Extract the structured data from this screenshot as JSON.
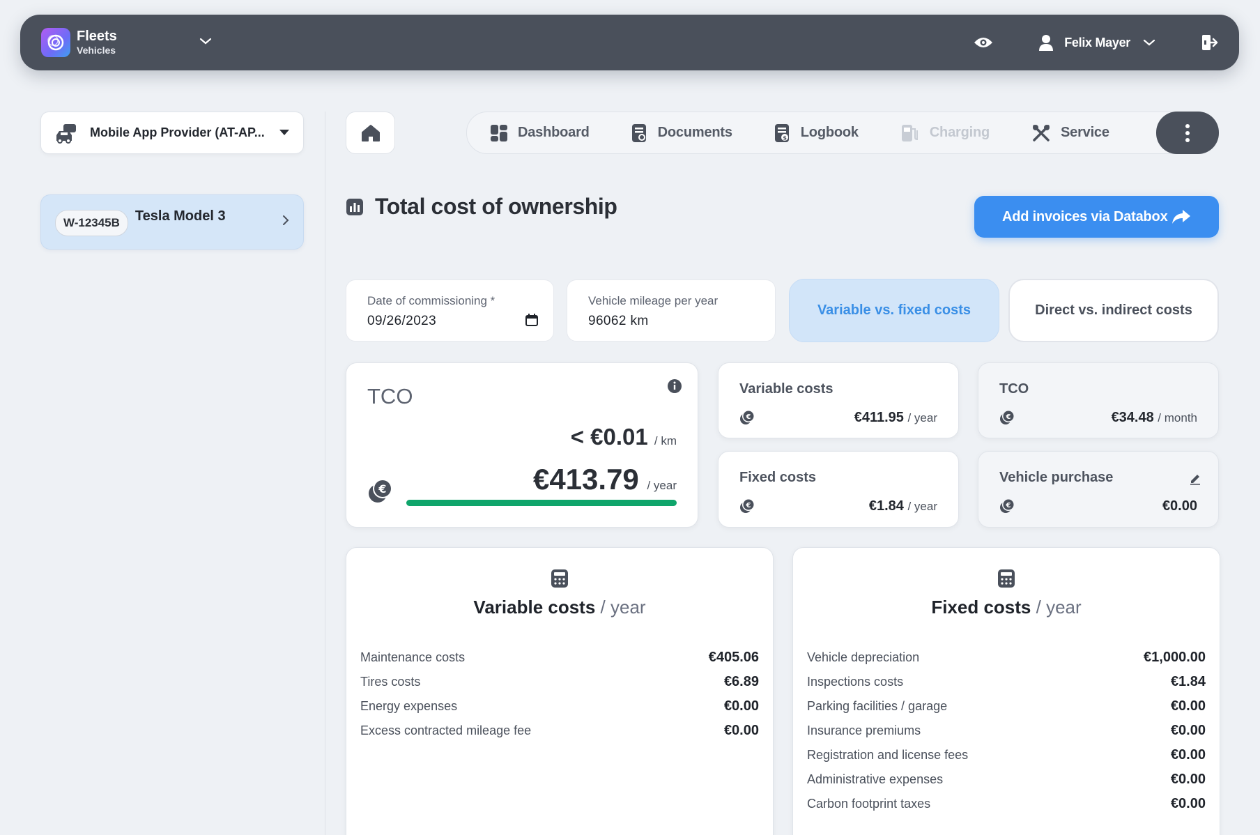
{
  "app": {
    "name": "Fleets",
    "section": "Vehicles"
  },
  "user": {
    "name": "Felix Mayer"
  },
  "provider": {
    "label": "Mobile App Provider (AT-AP..."
  },
  "vehicle": {
    "plate": "W-12345B",
    "model": "Tesla Model 3"
  },
  "tabs": [
    {
      "label": "Dashboard",
      "icon": "dashboard-icon",
      "disabled": false
    },
    {
      "label": "Documents",
      "icon": "documents-icon",
      "disabled": false
    },
    {
      "label": "Logbook",
      "icon": "logbook-icon",
      "disabled": false
    },
    {
      "label": "Charging",
      "icon": "charging-icon",
      "disabled": true
    },
    {
      "label": "Service",
      "icon": "service-icon",
      "disabled": false
    }
  ],
  "page": {
    "title": "Total cost of ownership",
    "databox_button": "Add invoices via Databox"
  },
  "fields": {
    "commissioning": {
      "label": "Date of commissioning *",
      "value": "09/26/2023"
    },
    "mileage": {
      "label": "Vehicle mileage per year",
      "value": "96062 km"
    }
  },
  "toggles": {
    "variable_fixed": "Variable vs. fixed costs",
    "direct_indirect": "Direct vs. indirect costs"
  },
  "tco": {
    "title": "TCO",
    "per_km": "< €0.01",
    "per_km_unit": "/ km",
    "per_year": "€413.79",
    "per_year_unit": "/ year",
    "bar_fraction": 1.0
  },
  "summary": {
    "variable": {
      "title": "Variable costs",
      "value": "€411.95",
      "unit": "/ year"
    },
    "fixed": {
      "title": "Fixed costs",
      "value": "€1.84",
      "unit": "/ year"
    },
    "tco_month": {
      "title": "TCO",
      "value": "€34.48",
      "unit": "/ month"
    },
    "purchase": {
      "title": "Vehicle purchase",
      "value": "€0.00"
    }
  },
  "variable_costs": {
    "title": "Variable costs",
    "unit": "/ year",
    "rows": [
      {
        "label": "Maintenance costs",
        "value": "€405.06"
      },
      {
        "label": "Tires costs",
        "value": "€6.89"
      },
      {
        "label": "Energy expenses",
        "value": "€0.00"
      },
      {
        "label": "Excess contracted mileage fee",
        "value": "€0.00"
      }
    ]
  },
  "fixed_costs": {
    "title": "Fixed costs",
    "unit": "/ year",
    "rows": [
      {
        "label": "Vehicle depreciation",
        "value": "€1,000.00"
      },
      {
        "label": "Inspections costs",
        "value": "€1.84"
      },
      {
        "label": "Parking facilities / garage",
        "value": "€0.00"
      },
      {
        "label": "Insurance premiums",
        "value": "€0.00"
      },
      {
        "label": "Registration and license fees",
        "value": "€0.00"
      },
      {
        "label": "Administrative expenses",
        "value": "€0.00"
      },
      {
        "label": "Carbon footprint taxes",
        "value": "€0.00"
      }
    ]
  },
  "colors": {
    "accent": "#3b8ef0",
    "topbar": "#4a505b",
    "progress": "#0fa56b",
    "active_toggle": "#d2e5f9"
  }
}
